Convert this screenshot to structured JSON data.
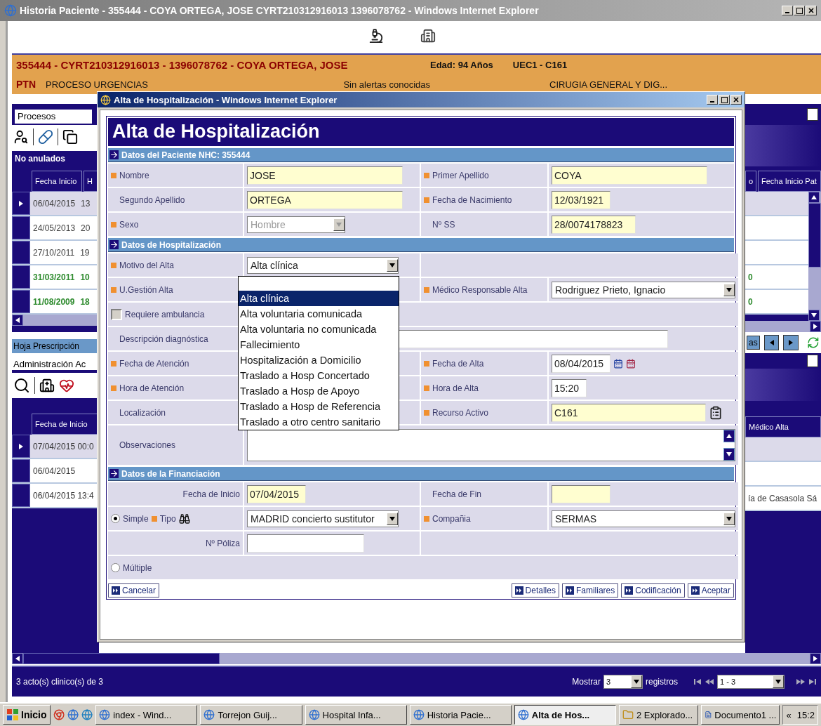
{
  "window": {
    "title": "Historia Paciente - 355444 - COYA ORTEGA, JOSE CYRT210312916013 1396078762 - Windows Internet Explorer"
  },
  "header": {
    "patient": "355444 - CYRT210312916013 - 1396078762 - COYA ORTEGA, JOSE",
    "age": "Edad: 94 Años",
    "unit": "UEC1 - C161",
    "code": "PTN",
    "process": "PROCESO URGENCIAS",
    "alerts": "Sin alertas conocidas",
    "service": "CIRUGIA GENERAL Y DIG..."
  },
  "left_panel": {
    "tab": "Procesos",
    "filter": "No anulados",
    "columns": [
      "Fecha Inicio",
      "H"
    ],
    "rows": [
      {
        "cells": [
          "06/04/2015",
          "13"
        ],
        "selected": true,
        "color": "#404040"
      },
      {
        "cells": [
          "24/05/2013",
          "20"
        ],
        "selected": false,
        "color": "#404040"
      },
      {
        "cells": [
          "27/10/2011",
          "19"
        ],
        "selected": false,
        "color": "#404040"
      },
      {
        "cells": [
          "31/03/2011",
          "10"
        ],
        "selected": false,
        "color": "#2e8b2e"
      },
      {
        "cells": [
          "11/08/2009",
          "18"
        ],
        "selected": false,
        "color": "#2e8b2e"
      }
    ],
    "sheet_title": "Hoja Prescripción",
    "sheet_tab": "Administración Ac",
    "sheet_columns": [
      "Fecha de Inicio"
    ],
    "sheet_rows": [
      {
        "cells": [
          "07/04/2015 00:0"
        ],
        "selected": true
      },
      {
        "cells": [
          "06/04/2015"
        ],
        "selected": false
      },
      {
        "cells": [
          "06/04/2015 13:4"
        ],
        "selected": false
      }
    ]
  },
  "right_panel": {
    "columns": [
      "o",
      "Fecha Inicio Pat"
    ],
    "rows": [
      {
        "selected": true
      },
      {
        "selected": false
      },
      {
        "selected": false
      },
      {
        "selected": false,
        "text": "0",
        "color": "#2e8b2e"
      },
      {
        "selected": false,
        "text": "0",
        "color": "#2e8b2e"
      }
    ],
    "tab_button": "as",
    "sheet_columns": [
      "Médico Alta"
    ],
    "sheet_rows": [
      {
        "selected": true
      },
      {
        "selected": false
      },
      {
        "selected": false,
        "text": "ía de Casasola Sá"
      }
    ]
  },
  "status_bar": {
    "count": "3 acto(s) clinico(s) de 3",
    "show_label": "Mostrar",
    "page_size": "3",
    "records_label": "registros",
    "range": "1 - 3"
  },
  "dialog": {
    "title": "Alta de Hospitalización - Windows Internet Explorer",
    "heading": "Alta de Hospitalización",
    "sections": [
      {
        "title": "Datos del Paciente NHC: 355444",
        "rows": [
          {
            "cells": [
              {
                "kind": "label",
                "text": "Nombre",
                "required": true
              },
              {
                "kind": "text",
                "value": "JOSE",
                "highlighted": true
              },
              {
                "kind": "label",
                "text": "Primer Apellido",
                "required": true
              },
              {
                "kind": "text",
                "value": "COYA",
                "highlighted": true
              }
            ]
          },
          {
            "cells": [
              {
                "kind": "label",
                "text": "Segundo Apellido",
                "required": false
              },
              {
                "kind": "text",
                "value": "ORTEGA",
                "highlighted": true
              },
              {
                "kind": "label",
                "text": "Fecha de Nacimiento",
                "required": true
              },
              {
                "kind": "date",
                "value": "12/03/1921",
                "highlighted": true
              }
            ]
          },
          {
            "cells": [
              {
                "kind": "label",
                "text": "Sexo",
                "required": true
              },
              {
                "kind": "select",
                "value": "Hombre",
                "disabled": true,
                "highlighted": false
              },
              {
                "kind": "label",
                "text": "Nº SS",
                "required": false
              },
              {
                "kind": "number",
                "value": "28/0074178823",
                "highlighted": true
              }
            ]
          }
        ]
      },
      {
        "title": "Datos de Hospitalización",
        "rows": [
          {
            "cells": [
              {
                "kind": "label",
                "text": "Motivo del Alta",
                "required": true
              },
              {
                "kind": "select",
                "value": "Alta clínica",
                "disabled": false,
                "highlighted": false
              },
              {
                "kind": "blank"
              }
            ]
          },
          {
            "cells": [
              {
                "kind": "label",
                "text": "U.Gestión Alta",
                "required": true
              },
              {
                "kind": "blank"
              },
              {
                "kind": "label",
                "text": "Médico Responsable Alta",
                "required": true
              },
              {
                "kind": "select",
                "value": "Rodriguez Prieto, Ignacio",
                "disabled": false,
                "highlighted": false
              }
            ]
          },
          {
            "cells": [
              {
                "kind": "checkbox",
                "text": "Requiere ambulancia",
                "checked": false
              },
              {
                "kind": "blank"
              }
            ]
          },
          {
            "cells": [
              {
                "kind": "label",
                "text": "Descripción diagnóstica",
                "required": false
              },
              {
                "kind": "wide",
                "highlighted": false
              }
            ]
          },
          {
            "cells": [
              {
                "kind": "label",
                "text": "Fecha de Atención",
                "required": true
              },
              {
                "kind": "blank"
              },
              {
                "kind": "label",
                "text": "Fecha de Alta",
                "required": true
              },
              {
                "kind": "datepicker",
                "value": "08/04/2015",
                "highlighted": false
              }
            ]
          },
          {
            "cells": [
              {
                "kind": "label",
                "text": "Hora de Atención",
                "required": true
              },
              {
                "kind": "blank"
              },
              {
                "kind": "label",
                "text": "Hora de Alta",
                "required": true
              },
              {
                "kind": "time",
                "value": "15:20",
                "highlighted": false
              }
            ]
          },
          {
            "cells": [
              {
                "kind": "label",
                "text": "Localización",
                "required": false
              },
              {
                "kind": "blank"
              },
              {
                "kind": "label",
                "text": "Recurso Activo",
                "required": true
              },
              {
                "kind": "lookup",
                "value": "C161",
                "highlighted": true
              }
            ]
          },
          {
            "cells": [
              {
                "kind": "label",
                "text": "Observaciones",
                "required": false
              },
              {
                "kind": "textarea",
                "highlighted": false
              }
            ]
          }
        ]
      },
      {
        "title": "Datos de la Financiación",
        "rows": [
          {
            "cells": [
              {
                "kind": "label",
                "text": "Fecha de Inicio",
                "required": false
              },
              {
                "kind": "date",
                "value": "07/04/2015",
                "highlighted": true
              },
              {
                "kind": "label",
                "text": "Fecha de Fin",
                "required": false
              },
              {
                "kind": "date",
                "highlighted": true
              }
            ]
          },
          {
            "cells": [
              {
                "kind": "radio",
                "text": "Simple",
                "selected": true,
                "field": "Tipo",
                "required": true
              },
              {
                "kind": "select",
                "value": "MADRID concierto sustitutor",
                "disabled": false,
                "highlighted": false
              },
              {
                "kind": "label",
                "text": "Compañia",
                "required": true
              },
              {
                "kind": "select",
                "value": "SERMAS",
                "disabled": false,
                "highlighted": false
              }
            ]
          },
          {
            "cells": [
              {
                "kind": "label",
                "text": "Nº Póliza",
                "required": false
              },
              {
                "kind": "number",
                "highlighted": false
              },
              {
                "kind": "blank"
              }
            ]
          },
          {
            "cells": [
              {
                "kind": "radio",
                "text": "Múltiple",
                "selected": false
              }
            ]
          }
        ]
      }
    ],
    "options": [
      {
        "label": "Alta clínica",
        "selected": true
      },
      {
        "label": "Alta voluntaria comunicada",
        "selected": false
      },
      {
        "label": "Alta voluntaria no comunicada",
        "selected": false
      },
      {
        "label": "Fallecimiento",
        "selected": false
      },
      {
        "label": "Hospitalización a Domicilio",
        "selected": false
      },
      {
        "label": "Traslado a Hosp Concertado",
        "selected": false
      },
      {
        "label": "Traslado a Hosp de Apoyo",
        "selected": false
      },
      {
        "label": "Traslado a Hosp de Referencia",
        "selected": false
      },
      {
        "label": "Traslado a otro centro sanitario",
        "selected": false
      }
    ],
    "buttons_left": [
      "Cancelar"
    ],
    "buttons_right": [
      "Detalles",
      "Familiares",
      "Codificación",
      "Aceptar"
    ]
  },
  "taskbar": {
    "start": "Inicio",
    "tasks": [
      {
        "label": "index - Wind...",
        "kind": "browser",
        "selected": false
      },
      {
        "label": "Torrejon Guij...",
        "kind": "browser",
        "selected": false
      },
      {
        "label": "Hospital Infa...",
        "kind": "browser",
        "selected": false
      },
      {
        "label": "Historia Pacie...",
        "kind": "browser",
        "selected": false
      },
      {
        "label": "Alta de Hos...",
        "kind": "browser",
        "selected": true
      },
      {
        "label": "2 Explorado...",
        "kind": "folder",
        "selected": false
      },
      {
        "label": "Documento1 ...",
        "kind": "document",
        "selected": false
      }
    ],
    "tray_toggle": "«",
    "clock": "15:2"
  }
}
